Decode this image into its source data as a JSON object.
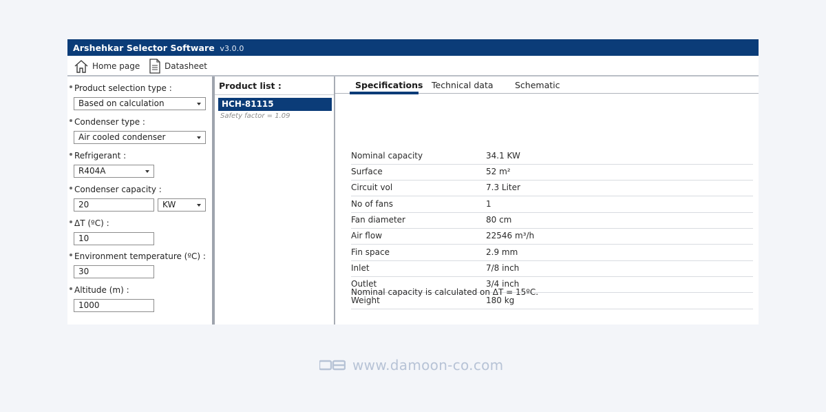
{
  "app": {
    "title": "Arshehkar Selector Software",
    "version": "v3.0.0"
  },
  "toolbar": {
    "home_label": "Home page",
    "datasheet_label": "Datasheet"
  },
  "form": {
    "product_selection_type": {
      "label": "Product selection type :",
      "value": "Based on calculation"
    },
    "condenser_type": {
      "label": "Condenser type :",
      "value": "Air cooled condenser"
    },
    "refrigerant": {
      "label": "Refrigerant :",
      "value": "R404A"
    },
    "condenser_capacity": {
      "label": "Condenser capacity :",
      "value": "20",
      "unit": "KW"
    },
    "delta_t": {
      "label": "ΔT (ºC) :",
      "value": "10"
    },
    "environment_temperature": {
      "label": "Environment temperature (ºC) :",
      "value": "30"
    },
    "altitude": {
      "label": "Altitude (m) :",
      "value": "1000"
    }
  },
  "product_list": {
    "header": "Product list :",
    "items": [
      {
        "name": "HCH-81115",
        "safety_factor": "Safety factor = 1.09"
      }
    ]
  },
  "tabs": [
    {
      "label": "Specifications",
      "active": true
    },
    {
      "label": "Technical data",
      "active": false
    },
    {
      "label": "Schematic",
      "active": false
    }
  ],
  "specifications": [
    {
      "key": "Nominal capacity",
      "value": "34.1 KW"
    },
    {
      "key": "Surface",
      "value": "52 m²"
    },
    {
      "key": "Circuit vol",
      "value": "7.3 Liter"
    },
    {
      "key": "No of fans",
      "value": "1"
    },
    {
      "key": "Fan diameter",
      "value": "80 cm"
    },
    {
      "key": "Air flow",
      "value": "22546 m³/h"
    },
    {
      "key": "Fin space",
      "value": "2.9 mm"
    },
    {
      "key": "Inlet",
      "value": "7/8 inch"
    },
    {
      "key": "Outlet",
      "value": "3/4 inch"
    },
    {
      "key": "Weight",
      "value": "180 kg"
    }
  ],
  "note": "Nominal capacity is calculated on ΔT = 15ºC.",
  "watermark": "www.damoon-co.com",
  "colors": {
    "title_bar": "#0b3c78",
    "selection": "#0b3c78",
    "page_background": "#f3f5f9",
    "watermark": "#b7c3d6"
  },
  "icons": {
    "home": "home-icon",
    "datasheet": "document-icon",
    "dropdown": "chevron-down-icon",
    "logo": "damoon-logo-icon"
  }
}
